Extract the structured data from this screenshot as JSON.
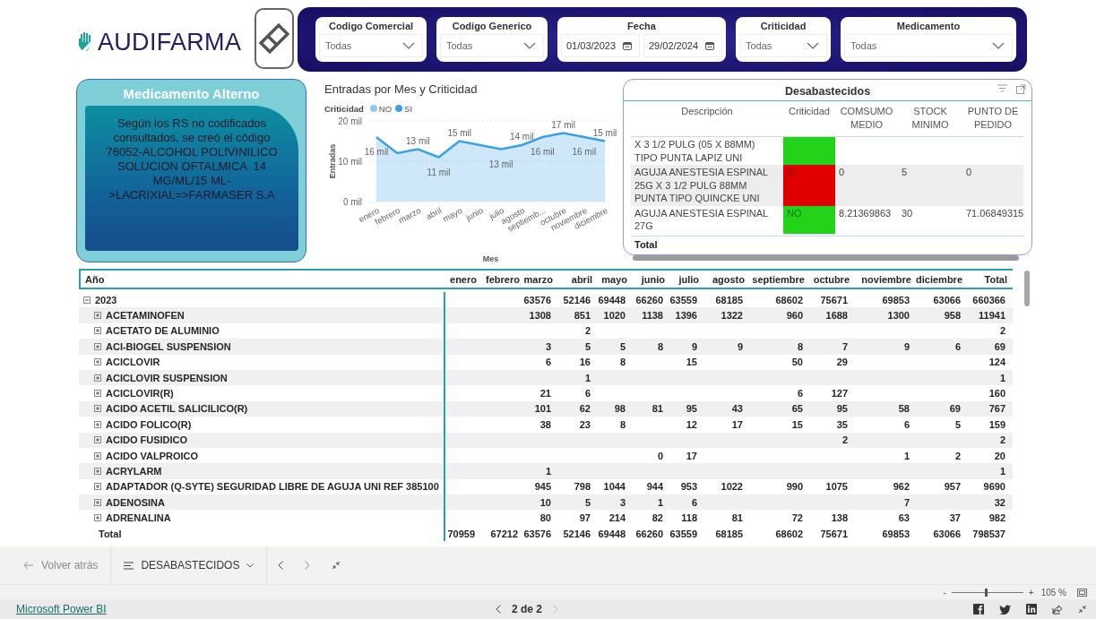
{
  "logo": {
    "text": "AUDIFARMA"
  },
  "filters": [
    {
      "kind": "dropdown",
      "label": "Codigo Comercial",
      "value": "Todas"
    },
    {
      "kind": "dropdown",
      "label": "Codigo Generico",
      "value": "Todas"
    },
    {
      "kind": "date_range",
      "label": "Fecha",
      "start": "01/03/2023",
      "end": "29/02/2024"
    },
    {
      "kind": "dropdown",
      "label": "Criticidad",
      "value": "Todas"
    },
    {
      "kind": "dropdown",
      "label": "Medicamento",
      "value": "Todas"
    }
  ],
  "alt_card": {
    "title": "Medicamento Alterno",
    "text": "Según los RS no codificados consultados, se creó el código 76052-ALCOHOL POLIVINILICO SOLUCION OFTALMICA  14 MG/ML/15 ML->LACRIXIAL=>FARMASER S.A"
  },
  "chart": {
    "legend_title": "Criticidad",
    "chart_data": {
      "type": "area",
      "title": "Entradas por Mes y Criticidad",
      "xlabel": "Mes",
      "ylabel": "Entradas",
      "categories": [
        "enero",
        "febrero",
        "marzo",
        "abril",
        "mayo",
        "junio",
        "julio",
        "agosto",
        "septiemb...",
        "octubre",
        "noviembre",
        "diciembre"
      ],
      "series": [
        {
          "name": "NO",
          "color": "#8ec9f5",
          "values": [
            null,
            null,
            null,
            null,
            null,
            null,
            null,
            null,
            null,
            null,
            null,
            null
          ]
        },
        {
          "name": "SI",
          "color": "#3aa0e8",
          "values": [
            16,
            12,
            13,
            11,
            15,
            14,
            13,
            14,
            16,
            17,
            16,
            15
          ]
        }
      ],
      "ylim": [
        0,
        20
      ],
      "yticks": [
        {
          "value": 0,
          "label": "0 mil"
        },
        {
          "value": 10,
          "label": "10 mil"
        },
        {
          "value": 20,
          "label": "20 mil"
        }
      ],
      "value_labels": [
        "16 mil",
        null,
        "13 mil",
        "11 mil",
        "15 mil",
        null,
        "13 mil",
        "14 mil",
        "16 mil",
        "17 mil",
        "16 mil",
        "15 mil"
      ]
    }
  },
  "desabastecidos": {
    "title": "Desabastecidos",
    "columns": [
      "Descripción",
      "Criticidad",
      "COMSUMO MEDIO",
      "STOCK MINIMO",
      "PUNTO DE PEDIDO"
    ],
    "rows": [
      {
        "description": "X 3 1/2 PULG (05 X 88MM) TIPO PUNTA LAPIZ UNI",
        "criticidad": "",
        "color": "#22d31a",
        "consumo": "",
        "stock": "",
        "punto": ""
      },
      {
        "description": "AGUJA ANESTESIA ESPINAL 25G X 3 1/2 PULG 88MM PUNTA TIPO QUINCKE UNI",
        "criticidad": "SI",
        "color": "#e00000",
        "consumo": "0",
        "stock": "5",
        "punto": "0"
      },
      {
        "description": "AGUJA ANESTESIA ESPINAL 27G",
        "criticidad": "NO",
        "color": "#22d31a",
        "consumo": "8.21369863",
        "stock": "30",
        "punto": "71.06849315"
      }
    ],
    "total": "Total"
  },
  "matrix": {
    "row_header": "Año",
    "columns": [
      "enero",
      "febrero",
      "marzo",
      "abril",
      "mayo",
      "junio",
      "julio",
      "agosto",
      "septiembre",
      "octubre",
      "noviembre",
      "diciembre",
      "Total"
    ],
    "rows": [
      {
        "label": "2023",
        "expanded": true,
        "cells": [
          "",
          "",
          "63576",
          "52146",
          "69448",
          "66260",
          "63559",
          "68185",
          "68602",
          "75671",
          "69853",
          "63066",
          "660366"
        ],
        "children": [
          {
            "label": "ACETAMINOFEN",
            "expanded": false,
            "cells": [
              "",
              "",
              "1308",
              "851",
              "1020",
              "1138",
              "1396",
              "1322",
              "960",
              "1688",
              "1300",
              "958",
              "11941"
            ]
          },
          {
            "label": "ACETATO DE ALUMINIO",
            "expanded": false,
            "cells": [
              "",
              "",
              "",
              "2",
              "",
              "",
              "",
              "",
              "",
              "",
              "",
              "",
              "2"
            ]
          },
          {
            "label": "ACI-BIOGEL SUSPENSION",
            "expanded": false,
            "cells": [
              "",
              "",
              "3",
              "5",
              "5",
              "8",
              "9",
              "9",
              "8",
              "7",
              "9",
              "6",
              "69"
            ]
          },
          {
            "label": "ACICLOVIR",
            "expanded": false,
            "cells": [
              "",
              "",
              "6",
              "16",
              "8",
              "",
              "15",
              "",
              "50",
              "29",
              "",
              "",
              "124"
            ]
          },
          {
            "label": "ACICLOVIR SUSPENSION",
            "expanded": false,
            "cells": [
              "",
              "",
              "",
              "1",
              "",
              "",
              "",
              "",
              "",
              "",
              "",
              "",
              "1"
            ]
          },
          {
            "label": "ACICLOVIR(R)",
            "expanded": false,
            "cells": [
              "",
              "",
              "21",
              "6",
              "",
              "",
              "",
              "",
              "6",
              "127",
              "",
              "",
              "160"
            ]
          },
          {
            "label": "ACIDO ACETIL SALICILICO(R)",
            "expanded": false,
            "cells": [
              "",
              "",
              "101",
              "62",
              "98",
              "81",
              "95",
              "43",
              "65",
              "95",
              "58",
              "69",
              "767"
            ]
          },
          {
            "label": "ACIDO FOLICO(R)",
            "expanded": false,
            "cells": [
              "",
              "",
              "38",
              "23",
              "8",
              "",
              "12",
              "17",
              "15",
              "35",
              "6",
              "5",
              "159"
            ]
          },
          {
            "label": "ACIDO FUSIDICO",
            "expanded": false,
            "cells": [
              "",
              "",
              "",
              "",
              "",
              "",
              "",
              "",
              "",
              "2",
              "",
              "",
              "2"
            ]
          },
          {
            "label": "ACIDO VALPROICO",
            "expanded": false,
            "cells": [
              "",
              "",
              "",
              "",
              "",
              "0",
              "17",
              "",
              "",
              "",
              "1",
              "2",
              "20"
            ]
          },
          {
            "label": "ACRYLARM",
            "expanded": false,
            "cells": [
              "",
              "",
              "1",
              "",
              "",
              "",
              "",
              "",
              "",
              "",
              "",
              "",
              "1"
            ]
          },
          {
            "label": "ADAPTADOR (Q-SYTE) SEGURIDAD LIBRE DE AGUJA UNI REF 385100",
            "expanded": false,
            "cells": [
              "",
              "",
              "945",
              "798",
              "1044",
              "944",
              "953",
              "1022",
              "990",
              "1075",
              "962",
              "957",
              "9690"
            ]
          },
          {
            "label": "ADENOSINA",
            "expanded": false,
            "cells": [
              "",
              "",
              "10",
              "5",
              "3",
              "1",
              "6",
              "",
              "",
              "",
              "7",
              "",
              "32"
            ]
          },
          {
            "label": "ADRENALINA",
            "expanded": false,
            "cells": [
              "",
              "",
              "80",
              "97",
              "214",
              "82",
              "118",
              "81",
              "72",
              "138",
              "63",
              "37",
              "982"
            ]
          }
        ]
      }
    ],
    "total": {
      "label": "Total",
      "cells": [
        "70959",
        "67212",
        "63576",
        "52146",
        "69448",
        "66260",
        "63559",
        "68185",
        "68602",
        "75671",
        "69853",
        "63066",
        "798537"
      ]
    }
  },
  "navbar": {
    "back": {
      "label": "Volver atrás",
      "disabled": true
    },
    "page_menu": "DESABASTECIDOS"
  },
  "zoom": {
    "minus": "-",
    "plus": "+",
    "level": 0.49,
    "percent": "105 %"
  },
  "footer": {
    "link": "Microsoft Power BI",
    "page": "2 de 2"
  }
}
